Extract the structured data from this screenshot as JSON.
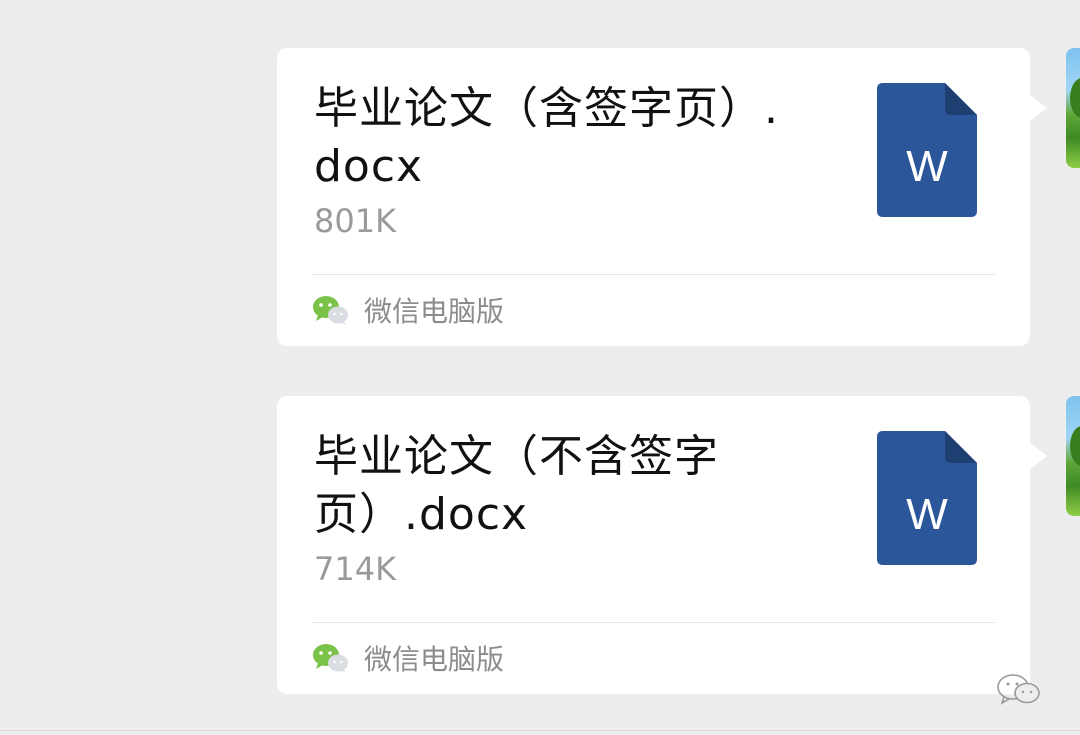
{
  "messages": [
    {
      "file_name": "毕业论文（含签字页）.docx",
      "file_size": "801K",
      "file_type_icon": "word-doc-icon",
      "file_icon_letter": "W",
      "source_label": "微信电脑版",
      "source_icon": "wechat-icon"
    },
    {
      "file_name": "毕业论文（不含签字页）.docx",
      "file_size": "714K",
      "file_type_icon": "word-doc-icon",
      "file_icon_letter": "W",
      "source_label": "微信电脑版",
      "source_icon": "wechat-icon"
    }
  ],
  "colors": {
    "background": "#ededed",
    "card": "#ffffff",
    "word_blue": "#2b579a",
    "wechat_green": "#7bc248"
  }
}
